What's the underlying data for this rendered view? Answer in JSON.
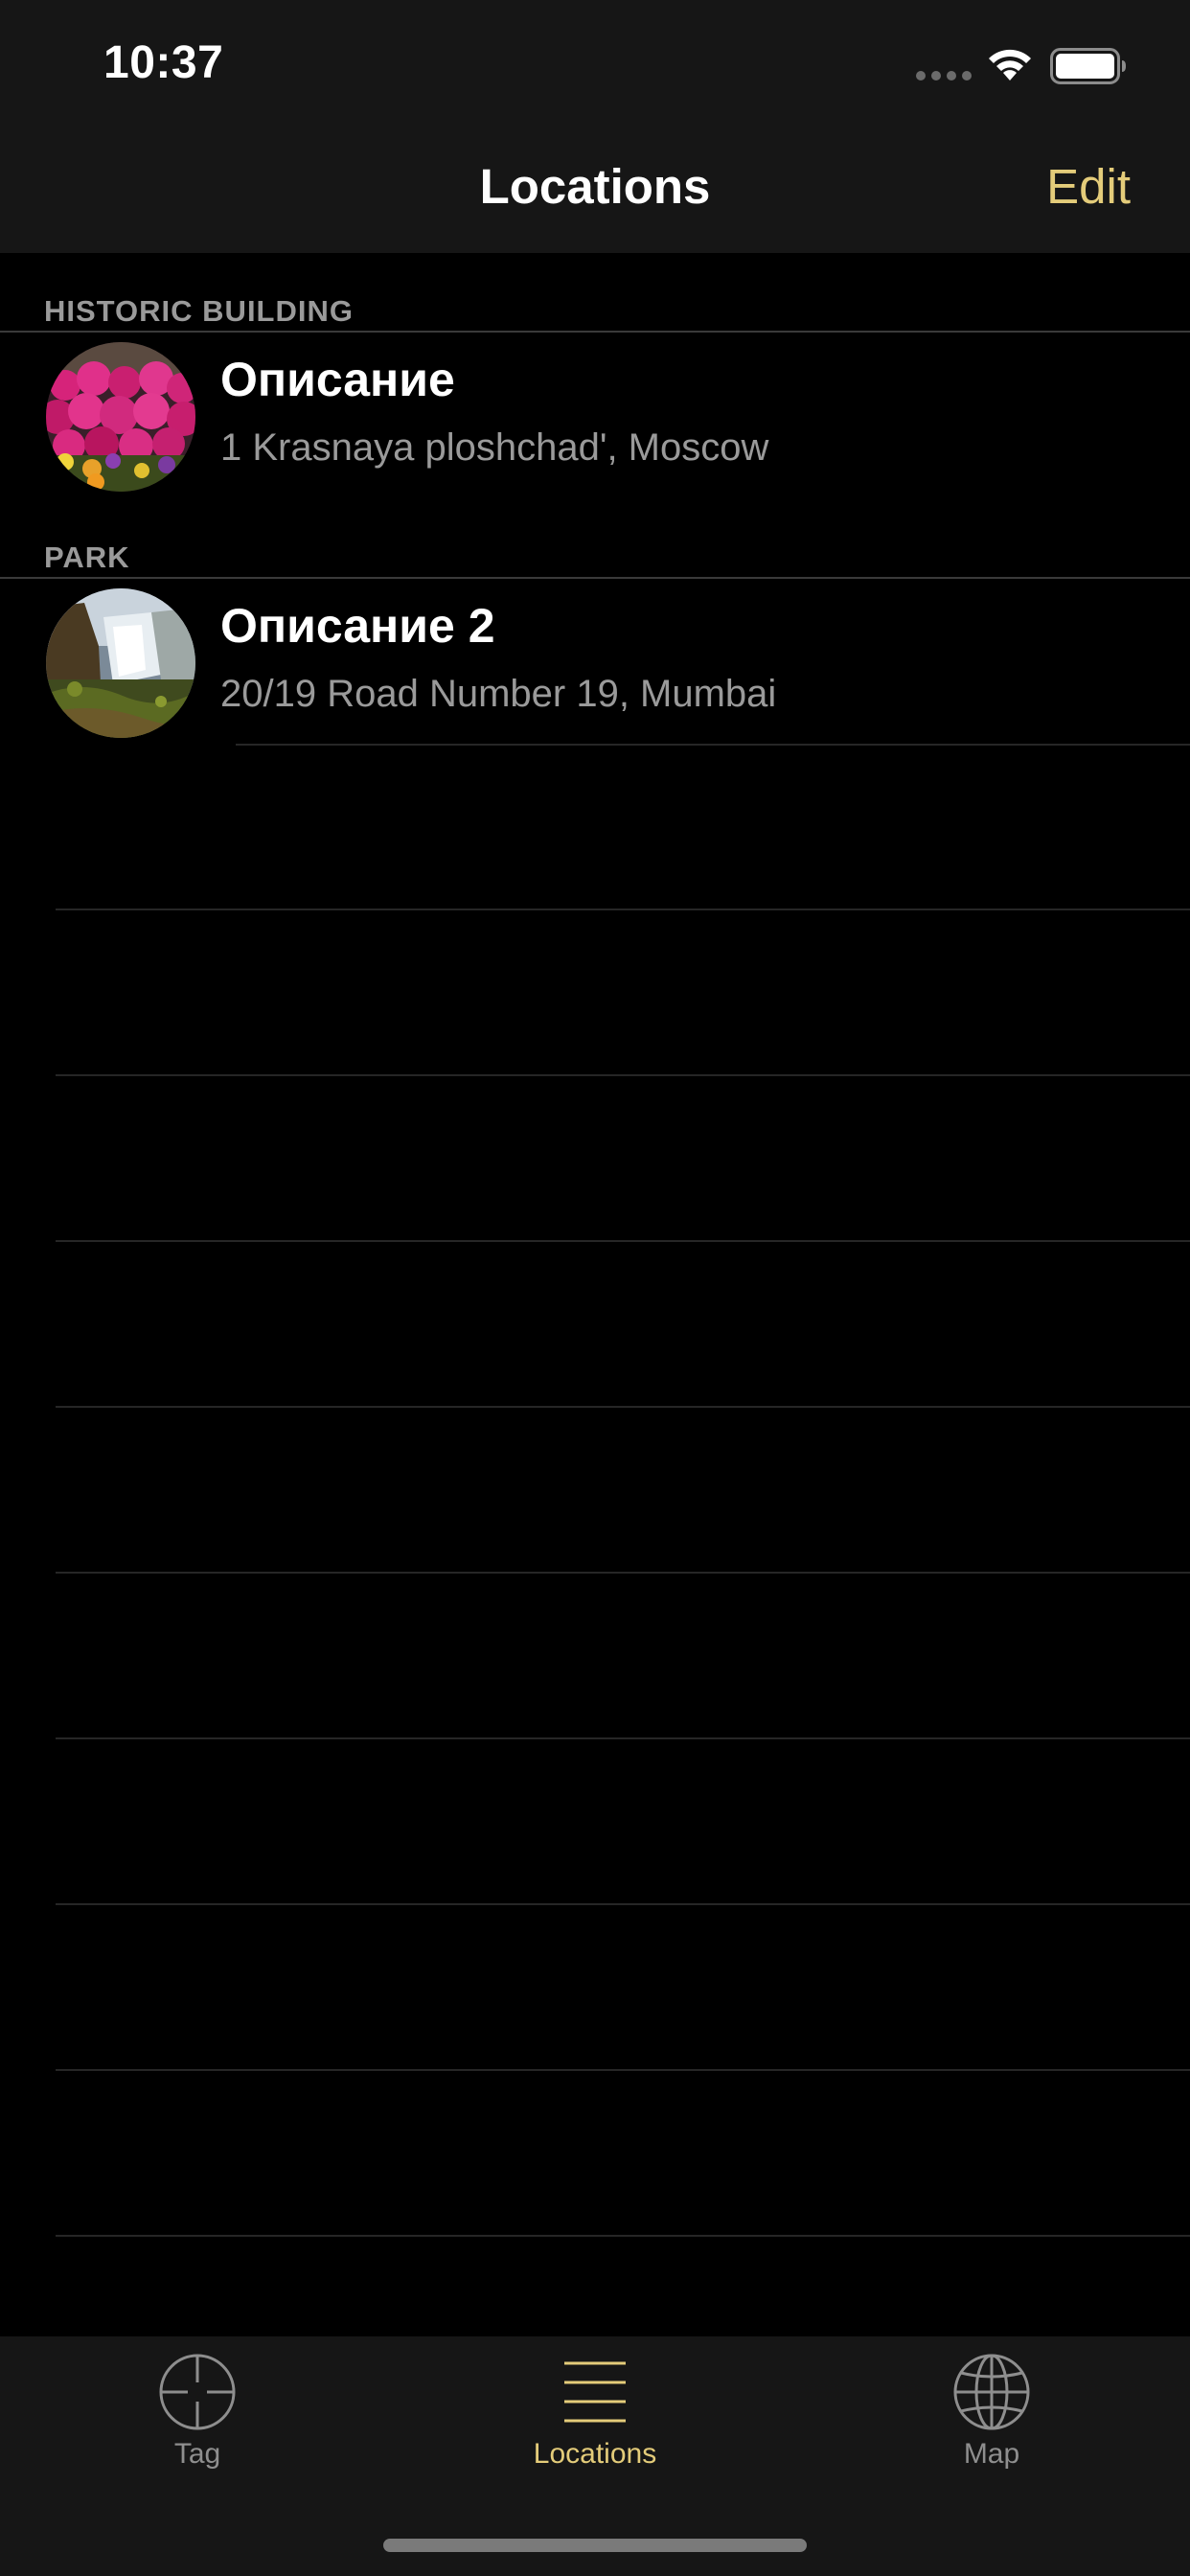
{
  "status_bar": {
    "time": "10:37"
  },
  "nav": {
    "title": "Locations",
    "edit_label": "Edit"
  },
  "sections": [
    {
      "header": "HISTORIC BUILDING",
      "rows": [
        {
          "title": "Описание",
          "subtitle": "1 Krasnaya ploshchad', Moscow",
          "thumbnail": "flowers-photo"
        }
      ]
    },
    {
      "header": "PARK",
      "rows": [
        {
          "title": "Описание 2",
          "subtitle": "20/19 Road Number 19, Mumbai",
          "thumbnail": "waterfall-photo"
        }
      ]
    }
  ],
  "tab_bar": {
    "tabs": [
      {
        "label": "Tag",
        "icon": "crosshair-icon",
        "selected": false
      },
      {
        "label": "Locations",
        "icon": "list-icon",
        "selected": true
      },
      {
        "label": "Map",
        "icon": "globe-icon",
        "selected": false
      }
    ]
  },
  "colors": {
    "accent": "#e4cc7a",
    "background": "#000000",
    "bar_background": "#161616",
    "secondary_text": "#9a9a9a",
    "inactive_tab": "#8e8e8e"
  }
}
